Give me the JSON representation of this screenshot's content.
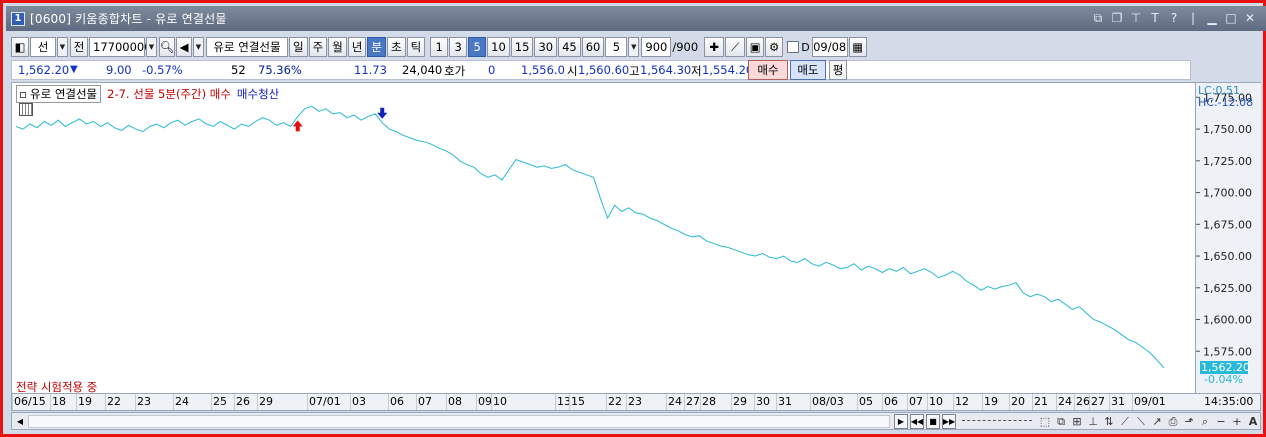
{
  "window": {
    "number": "1",
    "title": "[0600] 키움종합차트 - 유로 연결선물"
  },
  "toolbar": {
    "market_select": "선",
    "prev_label": "전",
    "code_value": "17700000",
    "name_value": "유로 연결선물",
    "period_buttons": [
      "일",
      "주",
      "월",
      "년",
      "분",
      "초",
      "틱"
    ],
    "active_period": "분",
    "interval_buttons": [
      "1",
      "3",
      "5",
      "10",
      "15",
      "30",
      "45",
      "60"
    ],
    "active_interval": "5",
    "interval_select": "5",
    "count_value": "900",
    "count_total": "/900",
    "date_value": "09/08",
    "checkbox_label": "D"
  },
  "quote": {
    "price": "1,562.20",
    "change": "9.00",
    "change_pct": "-0.57%",
    "volume": "52",
    "vol_ratio": "75.36%",
    "val1": "11.73",
    "val2": "24,040",
    "hoga_label": "호가",
    "hoga_value": "0",
    "hoga_price": "1,556.0",
    "open_label": "시",
    "open_value": "1,560.60",
    "high_label": "고",
    "high_value": "1,564.30",
    "low_label": "저",
    "low_value": "1,554.20",
    "buy_label": "매수",
    "sell_label": "매도",
    "avg_label": "평"
  },
  "legend": {
    "name": "유로 연결선물",
    "strategy": "2-7. 선물 5분(주간) 매수",
    "exit": "매수청산"
  },
  "strategy_status": "전략 시험적용 중",
  "y_axis": {
    "lc": "LC:0.51",
    "hc": "HC:-12.08",
    "last_price": "1,562.20",
    "last_pct": "-0.04%"
  },
  "colors": {
    "line": "#27b9d6",
    "buy_marker": "#e01010",
    "sell_marker": "#1020c0",
    "frame": "#e81010"
  },
  "chart_data": {
    "type": "line",
    "ylim": [
      1550,
      1780
    ],
    "yticks": [
      "1,775.00",
      "1,750.00",
      "1,725.00",
      "1,700.00",
      "1,675.00",
      "1,650.00",
      "1,625.00",
      "1,600.00",
      "1,575.00"
    ],
    "ytick_values": [
      1775,
      1750,
      1725,
      1700,
      1675,
      1650,
      1625,
      1600,
      1575
    ],
    "xtick_labels": [
      "06/15",
      "18",
      "19",
      "22",
      "23",
      "24",
      "25",
      "26",
      "29",
      "07/01",
      "03",
      "06",
      "07",
      "08",
      "09",
      "10",
      "13",
      "15",
      "22",
      "23",
      "24",
      "27",
      "28",
      "29",
      "30",
      "31",
      "08/03",
      "05",
      "06",
      "07",
      "10",
      "12",
      "19",
      "20",
      "21",
      "24",
      "26",
      "27",
      "31",
      "09/01"
    ],
    "time_label": "14:35:00",
    "series": [
      {
        "values": [
          1752,
          1750,
          1754,
          1751,
          1756,
          1753,
          1757,
          1752,
          1755,
          1758,
          1754,
          1756,
          1752,
          1755,
          1751,
          1749,
          1753,
          1750,
          1748,
          1752,
          1754,
          1751,
          1755,
          1757,
          1753,
          1756,
          1758,
          1754,
          1752,
          1756,
          1753,
          1750,
          1754,
          1752,
          1756,
          1759,
          1757,
          1753,
          1755,
          1752,
          1760,
          1766,
          1768,
          1764,
          1766,
          1762,
          1763,
          1759,
          1761,
          1757,
          1760,
          1762,
          1755,
          1750,
          1748,
          1745,
          1743,
          1741,
          1740,
          1738,
          1735,
          1733,
          1730,
          1725,
          1722,
          1720,
          1715,
          1712,
          1714,
          1710,
          1718,
          1726,
          1724,
          1722,
          1720,
          1721,
          1719,
          1720,
          1722,
          1718,
          1716,
          1714,
          1712,
          1695,
          1680,
          1690,
          1685,
          1688,
          1684,
          1683,
          1680,
          1678,
          1675,
          1672,
          1670,
          1667,
          1665,
          1666,
          1662,
          1660,
          1658,
          1657,
          1655,
          1653,
          1651,
          1650,
          1652,
          1649,
          1648,
          1650,
          1646,
          1645,
          1648,
          1644,
          1642,
          1645,
          1643,
          1640,
          1641,
          1644,
          1639,
          1642,
          1640,
          1637,
          1640,
          1638,
          1641,
          1636,
          1638,
          1640,
          1637,
          1633,
          1635,
          1638,
          1635,
          1630,
          1627,
          1623,
          1626,
          1624,
          1626,
          1627,
          1629,
          1621,
          1618,
          1620,
          1618,
          1614,
          1616,
          1612,
          1608,
          1610,
          1605,
          1600,
          1598,
          1595,
          1592,
          1588,
          1584,
          1582,
          1578,
          1574,
          1568,
          1562
        ]
      }
    ],
    "buy_marker_index": 40,
    "sell_marker_index": 52
  }
}
